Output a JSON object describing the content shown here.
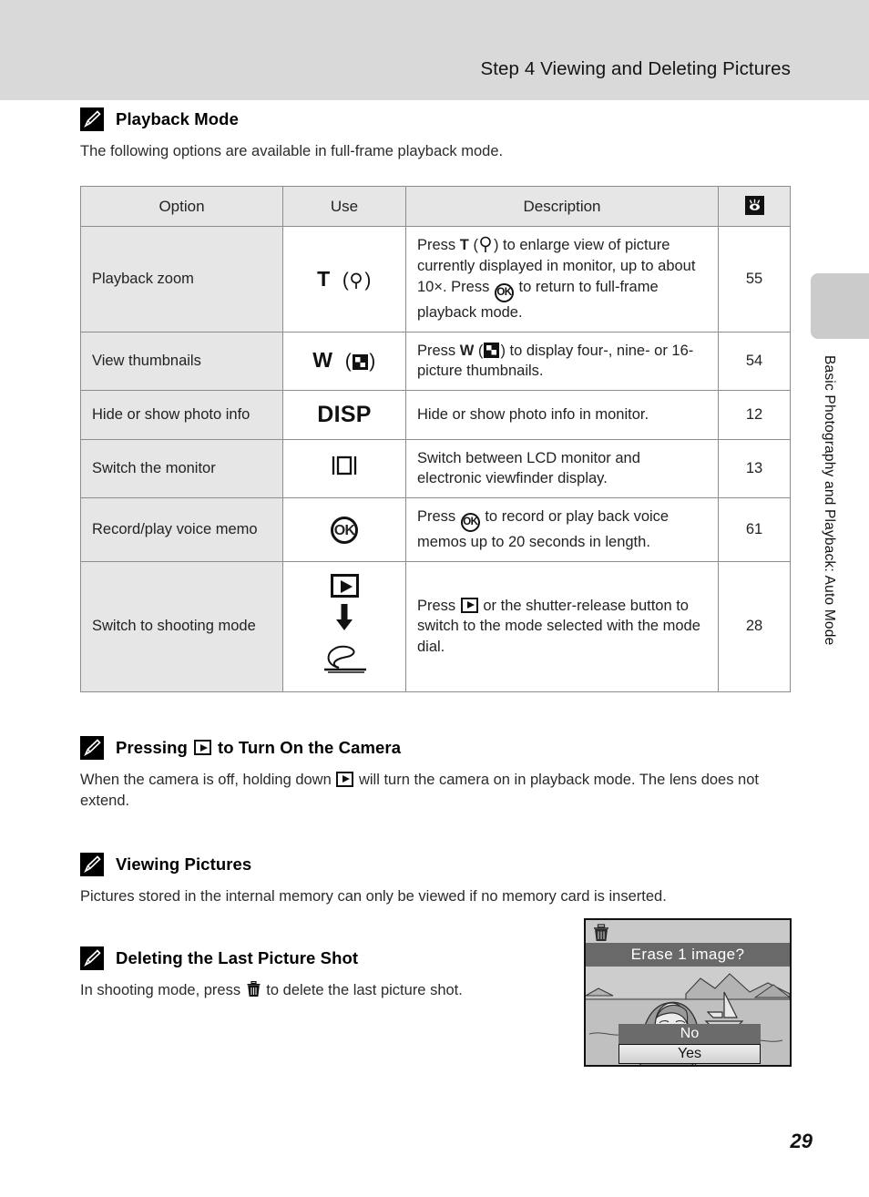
{
  "header": {
    "title": "Step 4 Viewing and Deleting Pictures"
  },
  "side_tab": {
    "label": "Basic Photography and Playback: Auto Mode"
  },
  "page_number": "29",
  "notes": [
    {
      "icon": "pencil-note-icon",
      "title": "Playback Mode",
      "body": "The following options are available in full-frame playback mode."
    },
    {
      "icon": "pencil-note-icon",
      "title_before": "Pressing",
      "title_icon": "playback-icon",
      "title_after": "to Turn On the Camera",
      "body_before": "When the camera is off, holding down",
      "body_icon": "playback-icon",
      "body_after": "will turn the camera on in playback mode. The lens does not extend."
    },
    {
      "icon": "pencil-note-icon",
      "title": "Viewing Pictures",
      "body": "Pictures stored in the internal memory can only be viewed if no memory card is inserted."
    },
    {
      "icon": "pencil-note-icon",
      "title": "Deleting the Last Picture Shot",
      "body_before": "In shooting mode, press",
      "body_icon": "trash-icon",
      "body_after": "to delete the last picture shot."
    }
  ],
  "table": {
    "headers": {
      "option": "Option",
      "use": "Use",
      "description": "Description",
      "page_ref_icon": "open-book-icon"
    },
    "rows": [
      {
        "option": "Playback zoom",
        "use_text": "T",
        "use_icon": "magnify-icon",
        "desc_parts": [
          "Press ",
          "T",
          " (",
          "magnify-icon",
          ") to enlarge view of picture currently displayed in monitor, up to about 10×. Press ",
          "ok-icon",
          " to return to full-frame playback mode."
        ],
        "page": "55"
      },
      {
        "option": "View thumbnails",
        "use_text": "W",
        "use_icon": "thumbnails-icon",
        "desc_parts": [
          "Press ",
          "W",
          " (",
          "thumbnails-icon",
          ") to display four-, nine- or 16- picture thumbnails."
        ],
        "page": "54"
      },
      {
        "option": "Hide or show photo info",
        "use_text": "DISP",
        "use_icon": "",
        "desc_plain": " Hide or show photo info in monitor.",
        "page": "12"
      },
      {
        "option": "Switch the monitor",
        "use_text": "",
        "use_icon": "monitor-switch-icon",
        "desc_plain": "Switch between LCD monitor and electronic viewfinder display.",
        "page": "13"
      },
      {
        "option": "Record/play voice memo",
        "use_text": "",
        "use_icon": "ok-icon",
        "desc_parts": [
          "Press ",
          "ok-icon",
          " to record or play back voice memos up to 20 seconds in length."
        ],
        "page": "61"
      },
      {
        "option": "Switch to shooting mode",
        "use_text": "",
        "use_icon": "playback-icon-arrow-shutter",
        "desc_parts": [
          "Press ",
          "playback-icon",
          " or the shutter-release button to switch to the mode selected with the mode dial."
        ],
        "page": "28"
      }
    ]
  },
  "lcd": {
    "trash_icon": "trash-icon",
    "question": "Erase 1 image?",
    "option_no": "No",
    "option_yes": "Yes",
    "selected": "Yes"
  },
  "colors": {
    "header_band": "#d9d9d9",
    "table_header": "#e6e6e6",
    "table_border": "#8d8d8d",
    "lcd_bar": "#696969",
    "side_tab": "#cbcbcb"
  }
}
